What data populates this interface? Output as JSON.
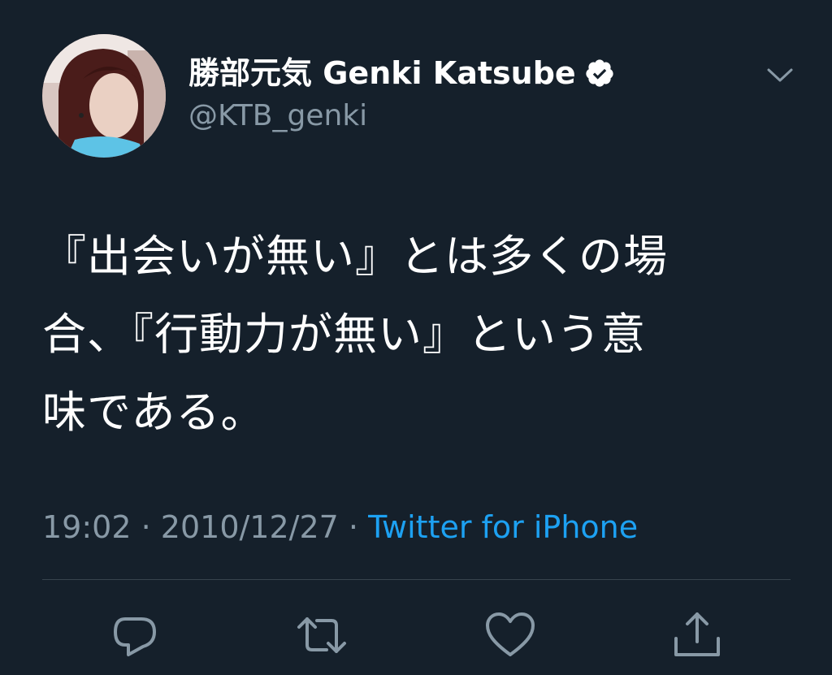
{
  "tweet": {
    "author": {
      "display_name": "勝部元気 Genki Katsube",
      "handle": "@KTB_genki",
      "verified": true
    },
    "text_lines": [
      "『出会いが無い』とは多くの場",
      "合、『行動力が無い』という意",
      "味である。"
    ],
    "time": "19:02",
    "date": "2010/12/27",
    "separator": "·",
    "source": "Twitter for iPhone"
  },
  "actions": {
    "reply": "reply-icon",
    "retweet": "retweet-icon",
    "like": "heart-icon",
    "share": "share-icon"
  },
  "colors": {
    "background": "#15202b",
    "text": "#ffffff",
    "secondary": "#8899a6",
    "accent": "#1da1f2",
    "divider": "#38444d"
  }
}
